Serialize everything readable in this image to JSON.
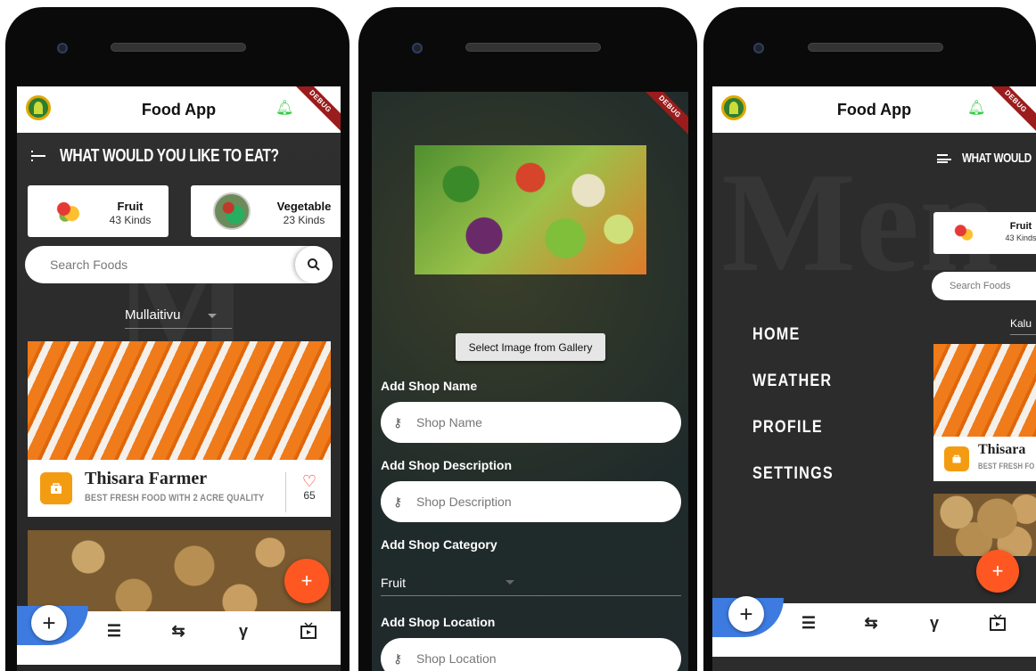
{
  "screen1": {
    "app_title": "Food App",
    "debug": "DEBUG",
    "heading": "WHAT WOULD YOU LIKE TO EAT?",
    "categories": [
      {
        "name": "Fruit",
        "count": "43 Kinds"
      },
      {
        "name": "Vegetable",
        "count": "23 Kinds"
      }
    ],
    "search_placeholder": "Search Foods",
    "location": "Mullaitivu",
    "post": {
      "shop_name": "Thisara Farmer",
      "description": "BEST FRESH FOOD WITH 2 ACRE QUALITY",
      "likes": "65"
    },
    "fab": "+"
  },
  "screen2": {
    "debug": "DEBUG",
    "gallery_button": "Select Image from Gallery",
    "label_name": "Add Shop Name",
    "placeholder_name": "Shop Name",
    "label_description": "Add Shop Description",
    "placeholder_description": "Shop Description",
    "label_category": "Add Shop Category",
    "category_value": "Fruit",
    "label_location": "Add Shop Location",
    "placeholder_location": "Shop Location"
  },
  "screen3": {
    "app_title": "Food App",
    "debug": "DEBUG",
    "menu": [
      "HOME",
      "WEATHER",
      "PROFILE",
      "SETTINGS"
    ],
    "heading": "WHAT WOULD",
    "category": {
      "name": "Fruit",
      "count": "43 Kinds"
    },
    "search_placeholder": "Search Foods",
    "location": "Kalu",
    "shop_name": "Thisara",
    "description": "BEST FRESH FO",
    "fab": "+"
  },
  "icons": {
    "bell": "bell-icon",
    "menu": "hamburger-icon",
    "search": "search-icon",
    "shop": "shop-icon",
    "heart": "heart-icon",
    "key": "key-icon",
    "add": "add-icon",
    "list": "list-icon",
    "compare": "compare-arrows-icon",
    "fork": "merge-icon",
    "video": "video-icon"
  },
  "colors": {
    "accent": "#ff5722",
    "brand_orange": "#f39c12",
    "nav_blue": "#3d7be0",
    "bell_green": "#2ecc40",
    "heart_red": "#e53935"
  }
}
